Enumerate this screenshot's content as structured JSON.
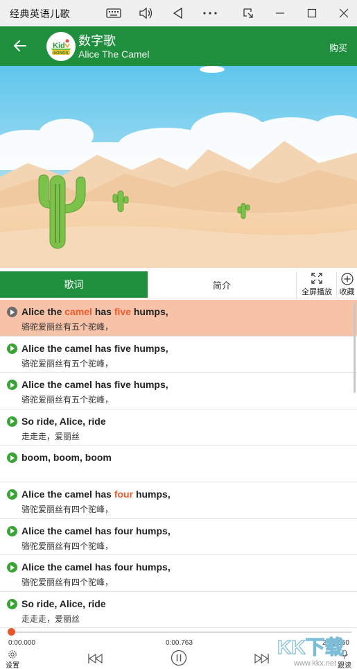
{
  "window": {
    "title": "经典英语儿歌",
    "icons": [
      "keyboard-icon",
      "volume-icon",
      "back-triangle-icon",
      "more-icon",
      "snip-icon",
      "minimize-icon",
      "maximize-icon",
      "close-icon"
    ]
  },
  "header": {
    "title": "数字歌",
    "subtitle": "Alice The Camel",
    "buy_label": "购买",
    "logo_text": "Kid SONGS",
    "color": "#1f8f3e"
  },
  "tabs": {
    "lyrics_label": "歌词",
    "intro_label": "简介",
    "fullscreen_label": "全屏播放",
    "favorite_label": "收藏"
  },
  "lyrics": [
    {
      "parts": [
        "Alice the ",
        "camel",
        " has ",
        "five",
        " humps,"
      ],
      "zh": "骆驼爱丽丝有五个驼峰，",
      "active": true
    },
    {
      "parts": [
        "Alice the camel has five humps,"
      ],
      "zh": "骆驼爱丽丝有五个驼峰，",
      "active": false
    },
    {
      "parts": [
        "Alice the camel has five humps,"
      ],
      "zh": "骆驼爱丽丝有五个驼峰，",
      "active": false
    },
    {
      "parts": [
        "So ride, Alice, ride"
      ],
      "zh": "走走走，爱丽丝",
      "active": false
    },
    {
      "parts": [
        "boom, boom, boom"
      ],
      "zh": "",
      "active": false
    },
    {
      "parts": [
        "Alice the camel has ",
        "four",
        " humps,"
      ],
      "zh": "骆驼爱丽丝有四个驼峰，",
      "active": false
    },
    {
      "parts": [
        "Alice the camel has four humps,"
      ],
      "zh": "骆驼爱丽丝有四个驼峰，",
      "active": false
    },
    {
      "parts": [
        "Alice the camel has four humps,"
      ],
      "zh": "骆驼爱丽丝有四个驼峰，",
      "active": false
    },
    {
      "parts": [
        "So ride, Alice, ride"
      ],
      "zh": "走走走，爱丽丝",
      "active": false
    }
  ],
  "player": {
    "time_start": "0:00.000",
    "time_current": "0:00.763",
    "time_total": "2:59.050",
    "progress_fraction": 0.004,
    "settings_label": "设置",
    "follow_label": "跟读"
  },
  "watermark": "KK下载 www.kkx.net"
}
